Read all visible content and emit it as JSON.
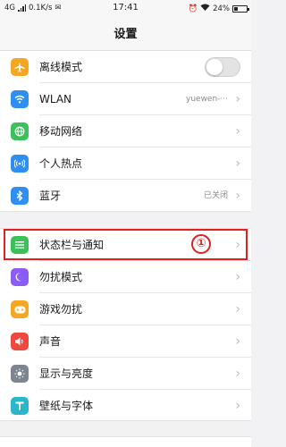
{
  "status_bar": {
    "network": "4G",
    "speed": "0.1K/s",
    "time": "17:41",
    "battery": "24%",
    "battery_level": 0.24
  },
  "header": {
    "title": "设置"
  },
  "groups": {
    "connectivity": [
      {
        "label": "离线模式",
        "toggle_on": false,
        "icon": "airplane-icon",
        "color": "#f5a623"
      },
      {
        "label": "WLAN",
        "value": "yuewen-···",
        "icon": "wifi-icon",
        "color": "#2f8ff0"
      },
      {
        "label": "移动网络",
        "icon": "globe-icon",
        "color": "#3cc15a"
      },
      {
        "label": "个人热点",
        "icon": "hotspot-icon",
        "color": "#2f8ff0"
      },
      {
        "label": "蓝牙",
        "value": "已关闭",
        "icon": "bluetooth-icon",
        "color": "#2f8ff0"
      }
    ],
    "system": [
      {
        "label": "状态栏与通知",
        "icon": "list-icon",
        "color": "#3cc15a"
      },
      {
        "label": "勿扰模式",
        "icon": "moon-icon",
        "color": "#8b5cf6"
      },
      {
        "label": "游戏勿扰",
        "icon": "gamepad-icon",
        "color": "#f5a623"
      },
      {
        "label": "声音",
        "icon": "speaker-icon",
        "color": "#f0483e"
      },
      {
        "label": "显示与亮度",
        "icon": "sun-icon",
        "color": "#7d8590"
      },
      {
        "label": "壁纸与字体",
        "icon": "font-icon",
        "color": "#2bb5c8"
      }
    ]
  },
  "annotation": {
    "number": "①",
    "color": "#e02020"
  }
}
